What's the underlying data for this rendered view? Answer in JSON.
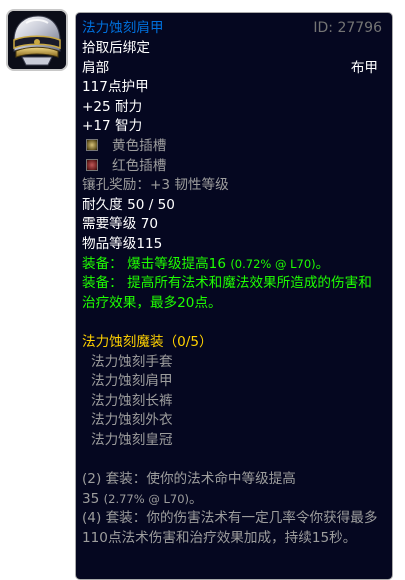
{
  "icon": {
    "name": "shoulder-armor-icon",
    "colors": {
      "metal": "#d8dbe6",
      "trim": "#c9a842",
      "band": "#1a1b2a"
    }
  },
  "tooltip": {
    "item_name": "法力蚀刻肩甲",
    "item_id": "ID: 27796",
    "bind": "拾取后绑定",
    "slot": "肩部",
    "armor_type": "布甲",
    "armor": "117点护甲",
    "stat1": "+25 耐力",
    "stat2": "+17 智力",
    "socket_yellow": "黄色插槽",
    "socket_red": "红色插槽",
    "socket_bonus": "镶孔奖励：+3 韧性等级",
    "durability": "耐久度 50 / 50",
    "required_level": "需要等级 70",
    "item_level": "物品等级115",
    "equip1_label": "装备：",
    "equip1_text": "爆击等级提高16",
    "equip1_note": "(0.72% @ L70)",
    "equip1_end": "。",
    "equip2_label": "装备：",
    "equip2_text": "提高所有法术和魔法效果所造成的伤害和治疗效果，最多20点。",
    "set_title": "法力蚀刻魔装（0/5）",
    "set_items": [
      "法力蚀刻手套",
      "法力蚀刻肩甲",
      "法力蚀刻长裤",
      "法力蚀刻外衣",
      "法力蚀刻皇冠"
    ],
    "bonus1_text": "(2) 套装：使你的法术命中等级提高",
    "bonus1_value": "35",
    "bonus1_note": "(2.77% @ L70)",
    "bonus1_end": "。",
    "bonus2_text": "(4) 套装：你的伤害法术有一定几率令你获得最多110点法术伤害和治疗效果加成，持续15秒。"
  },
  "colors": {
    "epic_blue": "#0070dd",
    "equip_green": "#1eff00",
    "set_gold": "#ffd100",
    "grey": "#9d9d9d",
    "background": "#050720"
  }
}
